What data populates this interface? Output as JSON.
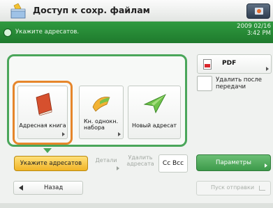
{
  "header": {
    "title": "Доступ к сохр. файлам",
    "app_icon": "folder-box-icon",
    "printer_icon": "printer-icon"
  },
  "status": {
    "message": "Укажите адресатов.",
    "date": "2009 02/16",
    "time": "3:42 PM",
    "icon": "info-icon"
  },
  "tiles": [
    {
      "label": "Адресная книга",
      "icon": "address-book-icon"
    },
    {
      "label": "Кн. однокн. набора",
      "icon": "one-touch-icon"
    },
    {
      "label": "Новый адресат",
      "icon": "new-address-icon"
    }
  ],
  "buttons": {
    "specify": "Укажите адресатов",
    "details": "Детали",
    "delete_recipient": "Удалить адресата",
    "cc_bcc": "Cc Bcc",
    "back": "Назад",
    "params": "Параметры",
    "send": "Пуск отправки"
  },
  "right_panel": {
    "format": "PDF",
    "format_icon": "pdf-icon",
    "delete_after_send": "Удалить после передачи",
    "delete_after_send_checked": false
  },
  "colors": {
    "accent_green": "#2f9a40",
    "highlight_orange": "#e6862b",
    "button_yellow": "#f1b426"
  }
}
